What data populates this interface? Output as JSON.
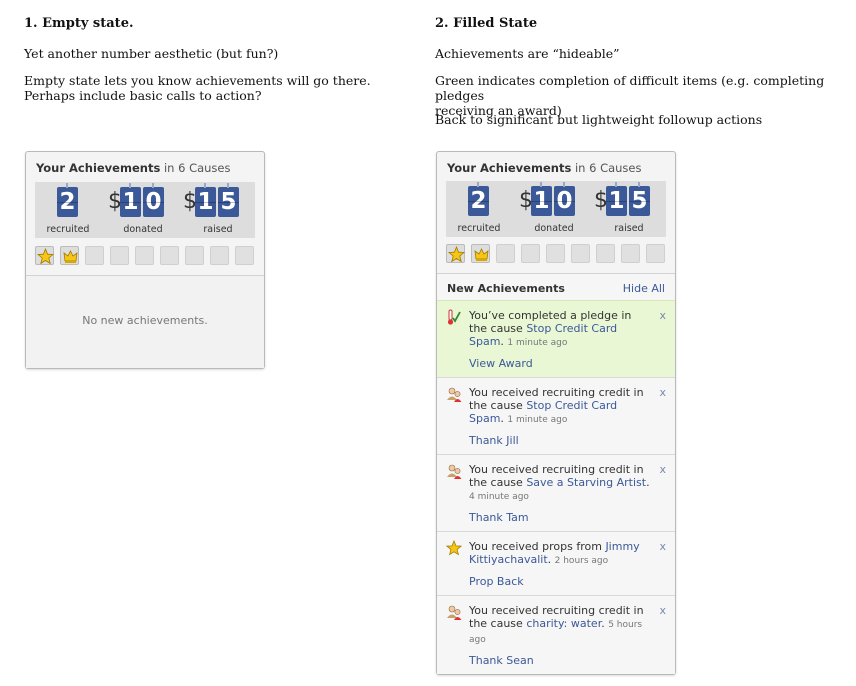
{
  "left": {
    "heading": "1. Empty state.",
    "para1": "Yet another number aesthetic (but fun?)",
    "para2_line1": "Empty state lets you know achievements will go there.",
    "para2_line2": "Perhaps include basic calls to action?"
  },
  "right": {
    "heading": "2. Filled State",
    "para1": "Achievements are “hideable”",
    "para2_line1": "Green indicates completion of difficult items (e.g. completing pledges",
    "para2_line2": "receiving an award)",
    "para3": "Back to significant but lightweight followup actions"
  },
  "widget": {
    "title_bold": "Your Achievements",
    "title_rest": " in 6 Causes",
    "recruited": "2",
    "recruited_label": "recruited",
    "donated_dollar": "$",
    "donated_d1": "1",
    "donated_d2": "0",
    "donated_label": "donated",
    "raised_dollar": "$",
    "raised_d1": "1",
    "raised_d2": "5",
    "raised_label": "raised",
    "empty_message": "No new achievements.",
    "new_title": "New Achievements",
    "hide_all": "Hide All",
    "close_glyph": "x",
    "icons": [
      "star-icon",
      "crown-icon",
      "thermometer-check-icon",
      "people-icon"
    ],
    "colors": {
      "tile": "#3b5998",
      "link": "#3b5998",
      "success_bg": "#e9f7d5"
    }
  },
  "items": [
    {
      "pre": "You’ve completed a pledge in the cause ",
      "link": "Stop Credit Card Spam",
      "post": ".",
      "time": "1 minute ago",
      "action": "View Award"
    },
    {
      "pre": "You received recruiting credit in the cause ",
      "link": "Stop Credit Card Spam",
      "post": ".",
      "time": "1 minute ago",
      "action": "Thank Jill"
    },
    {
      "pre": "You received recruiting credit in the cause ",
      "link": "Save a Starving Artist",
      "post": ".",
      "time": "4 minute ago",
      "action": "Thank Tam"
    },
    {
      "pre": "You received props from ",
      "link": "Jimmy Kittiyachavalit",
      "post": ".",
      "time": "2 hours ago",
      "action": "Prop Back"
    },
    {
      "pre": "You received recruiting credit in the cause ",
      "link": "charity: water",
      "post": ".",
      "time": "5 hours ago",
      "action": "Thank Sean"
    }
  ]
}
